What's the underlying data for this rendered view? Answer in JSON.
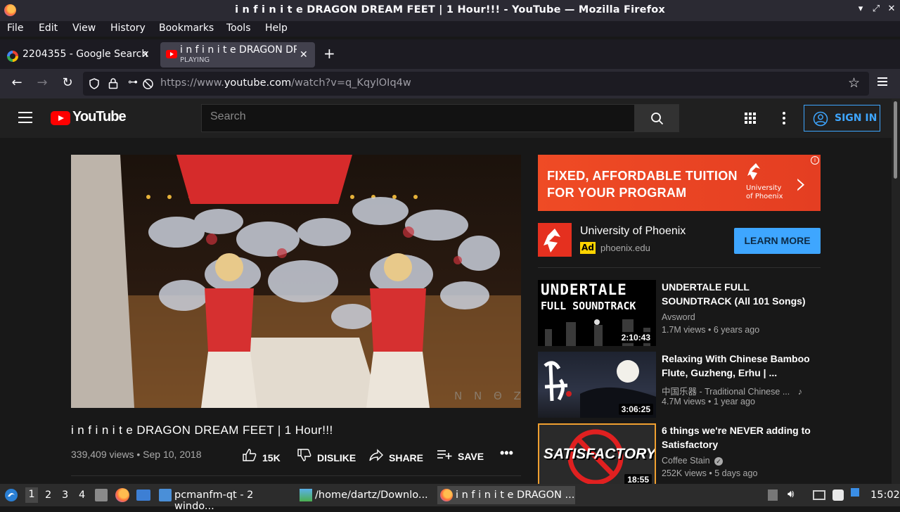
{
  "window": {
    "title": "i n f i n i t e DRAGON DREAM FEET | 1 Hour!!! - YouTube — Mozilla Firefox",
    "controls": [
      "▾",
      "⤢",
      "✕"
    ]
  },
  "menu": [
    "File",
    "Edit",
    "View",
    "History",
    "Bookmarks",
    "Tools",
    "Help"
  ],
  "tabs": [
    {
      "label": "2204355 - Google Search",
      "sub": ""
    },
    {
      "label": "i n f i n i t e DRAGON DRE",
      "sub": "PLAYING"
    }
  ],
  "url": {
    "prefix": "https://www.",
    "host": "youtube.com",
    "path": "/watch?v=q_KqylOIq4w"
  },
  "youtube": {
    "logo_text": "YouTube",
    "search_placeholder": "Search",
    "sign_in": "SIGN IN"
  },
  "video": {
    "title": "i n f i n i t e DRAGON DREAM FEET | 1 Hour!!!",
    "meta": "339,409 views • Sep 10, 2018",
    "watermark": "N N Θ Z",
    "likes": "15K",
    "dislike": "DISLIKE",
    "share": "SHARE",
    "save": "SAVE"
  },
  "ad": {
    "headline1": "FIXED, AFFORDABLE TUITION",
    "headline2": "FOR YOUR PROGRAM",
    "brand_line1": "University",
    "brand_line2": "of Phoenix",
    "advertiser": "University of Phoenix",
    "badge": "Ad",
    "domain": "phoenix.edu",
    "cta": "LEARN MORE"
  },
  "recommendations": [
    {
      "title": "UNDERTALE FULL SOUNDTRACK (All 101 Songs)",
      "thumb_text1": "UNDERTALE",
      "thumb_text2": "FULL SOUNDTRACK",
      "channel": "Avsword",
      "meta": "1.7M views • 6 years ago",
      "duration": "2:10:43"
    },
    {
      "title": "Relaxing With Chinese Bamboo Flute, Guzheng, Erhu | ...",
      "channel": "中国乐器 - Traditional Chinese ...",
      "meta": "4.7M views • 1 year ago",
      "duration": "3:06:25"
    },
    {
      "title": "6 things we're NEVER adding to Satisfactory",
      "thumb_text1": "SATISFACTORY",
      "channel": "Coffee Stain",
      "meta": "252K views • 5 days ago",
      "duration": "18:55"
    }
  ],
  "taskbar": {
    "workspaces": [
      "1",
      "2",
      "3",
      "4"
    ],
    "windows": [
      {
        "label": "pcmanfm-qt - 2 windo..."
      },
      {
        "label": "/home/dartz/Downlo..."
      },
      {
        "label": "i n f i n i t e DRAGON ..."
      }
    ],
    "clock": "15:02"
  },
  "colors": {
    "accent": "#3ea6ff",
    "yt_red": "#ff0000",
    "ad_orange": "#ef4b25"
  }
}
